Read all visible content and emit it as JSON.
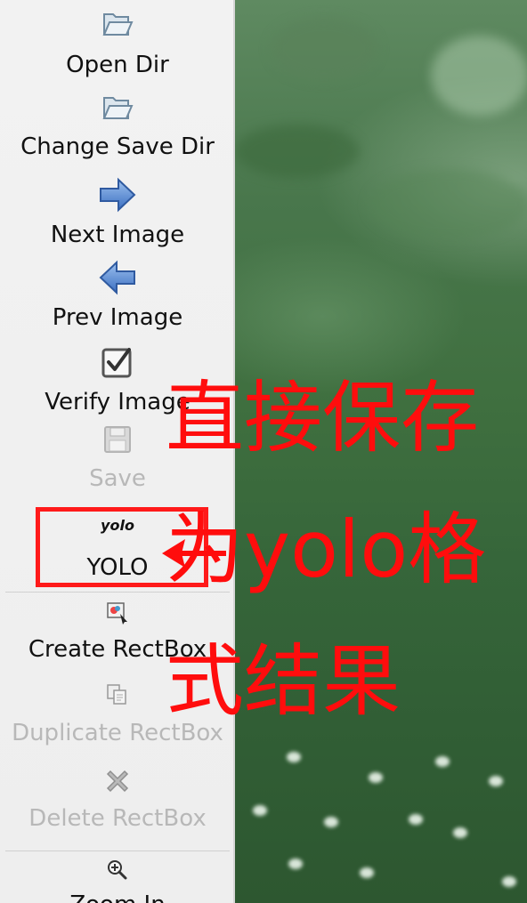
{
  "toolbar": {
    "open_dir": "Open Dir",
    "change_save_dir": "Change Save Dir",
    "next_image": "Next Image",
    "prev_image": "Prev Image",
    "verify_image": "Verify Image",
    "save": "Save",
    "yolo_icon_text": "yolo",
    "yolo": "YOLO",
    "create_rectbox": "Create RectBox",
    "duplicate_rectbox": "Duplicate RectBox",
    "delete_rectbox": "Delete RectBox",
    "zoom_in": "Zoom In"
  },
  "annotation": {
    "line1": "直接保存",
    "line2": "为yolo格",
    "line3": "式结果"
  },
  "icons": {
    "open_dir": "folder-icon",
    "change_save_dir": "folder-icon",
    "next_image": "arrow-right-icon",
    "prev_image": "arrow-left-icon",
    "verify_image": "checkbox-icon",
    "save": "floppy-disk-icon",
    "yolo": "yolo-format-icon",
    "create_rectbox": "draw-rect-icon",
    "duplicate_rectbox": "duplicate-icon",
    "delete_rectbox": "delete-x-icon",
    "zoom_in": "zoom-in-icon"
  },
  "colors": {
    "annotation_red": "#ff0d0d",
    "arrow_blue": "#4a7fd0",
    "disabled_text": "#b8b8b8"
  }
}
